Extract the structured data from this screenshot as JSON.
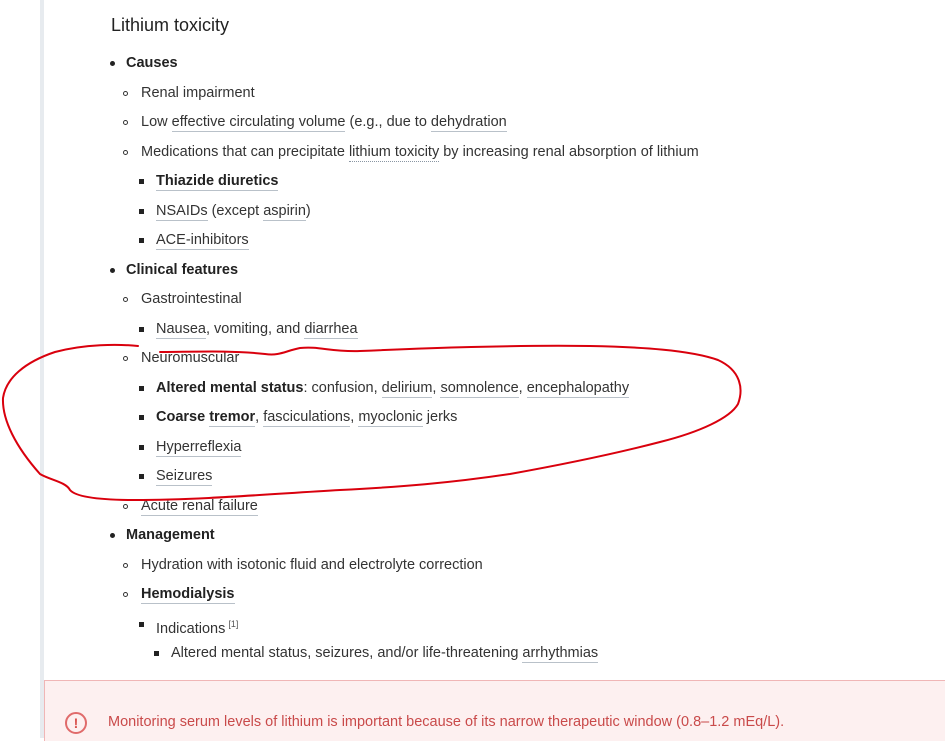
{
  "title": "Lithium toxicity",
  "causes": {
    "label": "Causes",
    "renal": "Renal impairment",
    "low_prefix": "Low ",
    "low_link": "effective circulating volume",
    "low_mid": " (e.g., due to ",
    "low_link2": "dehydration",
    "meds_prefix": "Medications that can precipitate ",
    "meds_link": "lithium toxicity",
    "meds_suffix": " by increasing renal absorption of lithium",
    "thiazide": "Thiazide diuretics",
    "nsaids_link": "NSAIDs",
    "nsaids_mid": " (except ",
    "nsaids_link2": "aspirin",
    "nsaids_end": ")",
    "ace": "ACE-inhibitors"
  },
  "clinical": {
    "label": "Clinical features",
    "gi": "Gastrointestinal",
    "nausea": "Nausea",
    "gi_mid": ", vomiting, and ",
    "diarrhea": "diarrhea",
    "neuro": "Neuromuscular",
    "ams_bold": "Altered mental status",
    "ams_mid": ": confusion, ",
    "delirium": "delirium",
    "comma1": ", ",
    "somnolence": "somnolence",
    "comma2": ", ",
    "encephalopathy": "encephalopathy",
    "coarse": "Coarse ",
    "tremor": "tremor",
    "comma3": ", ",
    "fasciculations": "fasciculations",
    "comma4": ", ",
    "myoclonic": "myoclonic",
    "jerks": " jerks",
    "hyperreflexia": "Hyperreflexia",
    "seizures": "Seizures",
    "arf": "Acute renal failure"
  },
  "management": {
    "label": "Management",
    "hydration": "Hydration with isotonic fluid and electrolyte correction",
    "hemodialysis": "Hemodialysis",
    "indications": "Indications",
    "ref": "[1]",
    "ind_text": "Altered mental status, seizures, and/or life-threatening ",
    "arrhythmias": "arrhythmias"
  },
  "alert": {
    "icon": "!",
    "text": "Monitoring serum levels of lithium is important because of its narrow therapeutic window (0.8–1.2 mEq/L)."
  },
  "colors": {
    "annotation": "#d9000d",
    "alert_text": "#c94a4a"
  }
}
